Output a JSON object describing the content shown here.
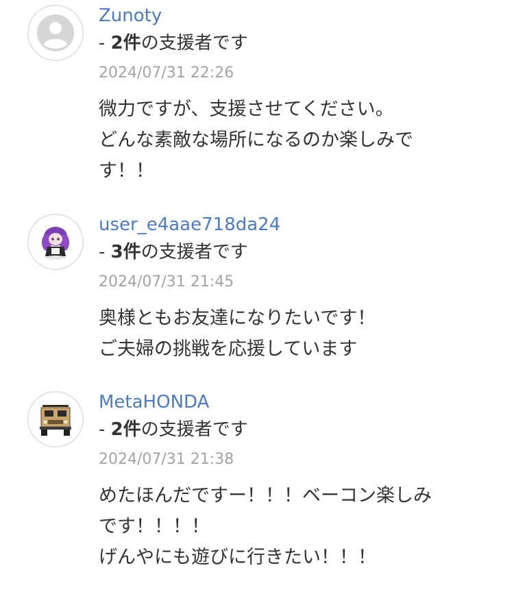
{
  "comments": [
    {
      "username": "Zunoty",
      "supporter_prefix": "- ",
      "supporter_count": "2件",
      "supporter_suffix": "の支援者です",
      "date": "2024/07/31 22:26",
      "lines": [
        "微力ですが、支援させてください。",
        "どんな素敵な場所になるのか楽しみで",
        "す！！"
      ]
    },
    {
      "username": "user_e4aae718da24",
      "supporter_prefix": "- ",
      "supporter_count": "3件",
      "supporter_suffix": "の支援者です",
      "date": "2024/07/31 21:45",
      "lines": [
        "奥様ともお友達になりたいです！",
        "ご夫婦の挑戦を応援しています"
      ]
    },
    {
      "username": "MetaHONDA",
      "supporter_prefix": "- ",
      "supporter_count": "2件",
      "supporter_suffix": "の支援者です",
      "date": "2024/07/31 21:38",
      "lines": [
        "めたほんだですー！！！ベーコン楽しみ",
        "です！！！！",
        "げんやにも遊びに行きたい！！！"
      ]
    }
  ]
}
